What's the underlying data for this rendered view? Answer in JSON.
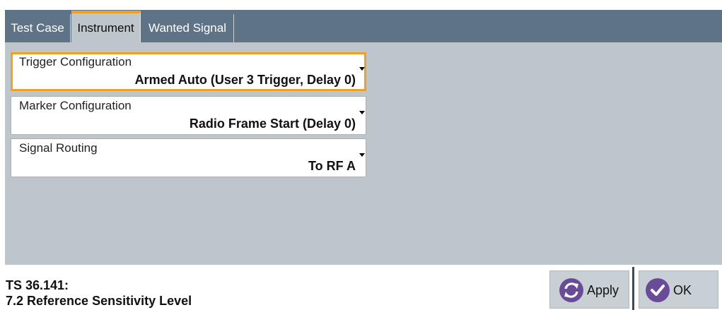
{
  "tabs": [
    {
      "label": "Test Case",
      "active": false
    },
    {
      "label": "Instrument",
      "active": true
    },
    {
      "label": "Wanted Signal",
      "active": false
    }
  ],
  "fields": {
    "trigger": {
      "label": "Trigger Configuration",
      "value": "Armed Auto (User 3 Trigger, Delay 0)"
    },
    "marker": {
      "label": "Marker Configuration",
      "value": "Radio Frame Start (Delay 0)"
    },
    "routing": {
      "label": "Signal Routing",
      "value": "To RF A"
    }
  },
  "footer": {
    "line1": "TS 36.141:",
    "line2": "7.2 Reference Sensitivity Level"
  },
  "buttons": {
    "apply_label": "Apply",
    "ok_label": "OK"
  },
  "icons": {
    "apply": "refresh-arrows-icon",
    "ok": "checkmark-icon"
  },
  "colors": {
    "accent": "#f0a024",
    "tabbar": "#5f7387",
    "panel": "#bfc6cb",
    "icon_purple": "#6a4b97"
  }
}
